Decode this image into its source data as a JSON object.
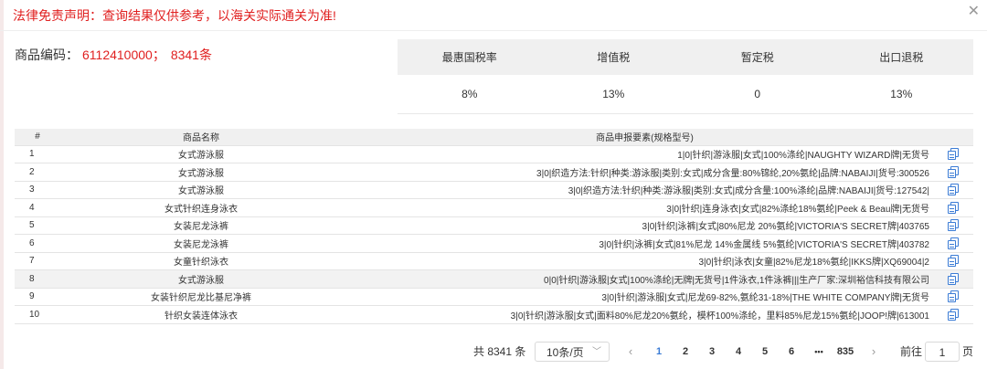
{
  "header": {
    "disclaimer": "法律免责声明：查询结果仅供参考，以海关实际通关为准!",
    "close_icon": "close-icon"
  },
  "product": {
    "code_label": "商品编码：",
    "code": "6112410000；",
    "count": "8341条"
  },
  "tax": {
    "headers": [
      "最惠国税率",
      "增值税",
      "暂定税",
      "出口退税"
    ],
    "values": [
      "8%",
      "13%",
      "0",
      "13%"
    ]
  },
  "table": {
    "headers": {
      "num": "#",
      "name": "商品名称",
      "spec": "商品申报要素(规格型号)"
    },
    "rows": [
      {
        "num": "1",
        "name": "女式游泳服",
        "spec": "1|0|针织|游泳服|女式|100%涤纶|NAUGHTY WIZARD牌|无货号"
      },
      {
        "num": "2",
        "name": "女式游泳服",
        "spec": "3|0|织造方法:针织|种类:游泳服|类别:女式|成分含量:80%锦纶,20%氨纶|品牌:NABAIJI|货号:300526"
      },
      {
        "num": "3",
        "name": "女式游泳服",
        "spec": "3|0|织造方法:针织|种类:游泳服|类别:女式|成分含量:100%涤纶|品牌:NABAIJI|货号:127542|"
      },
      {
        "num": "4",
        "name": "女式针织连身泳衣",
        "spec": "3|0|针织|连身泳衣|女式|82%涤纶18%氨纶|Peek & Beau牌|无货号"
      },
      {
        "num": "5",
        "name": "女装尼龙泳裤",
        "spec": "3|0|针织|泳裤|女式|80%尼龙 20%氨纶|VICTORIA'S SECRET牌|403765"
      },
      {
        "num": "6",
        "name": "女装尼龙泳裤",
        "spec": "3|0|针织|泳裤|女式|81%尼龙 14%金属线 5%氨纶|VICTORIA'S SECRET牌|403782"
      },
      {
        "num": "7",
        "name": "女童针织泳衣",
        "spec": "3|0|针织|泳衣|女童|82%尼龙18%氨纶|IKKS牌|XQ69004|2"
      },
      {
        "num": "8",
        "name": "女式游泳服",
        "spec": "0|0|针织|游泳服|女式|100%涤纶|无牌|无货号|1件泳衣,1件泳裤|||生产厂家:深圳裕信科技有限公司"
      },
      {
        "num": "9",
        "name": "女装针织尼龙比基尼净裤",
        "spec": "3|0|针织|游泳服|女式|尼龙69-82%,氨纶31-18%|THE WHITE COMPANY牌|无货号"
      },
      {
        "num": "10",
        "name": "针织女装连体泳衣",
        "spec": "3|0|针织|游泳服|女式|面料80%尼龙20%氨纶，模杯100%涤纶，里料85%尼龙15%氨纶|JOOP!牌|613001"
      }
    ]
  },
  "pagination": {
    "total": "共 8341 条",
    "page_size": "10条/页",
    "prev_icon": "‹",
    "next_icon": "›",
    "pages": [
      "1",
      "2",
      "3",
      "4",
      "5",
      "6"
    ],
    "ellipsis": "•••",
    "last": "835",
    "goto_label": "前往",
    "goto_value": "1",
    "unit": "页"
  }
}
